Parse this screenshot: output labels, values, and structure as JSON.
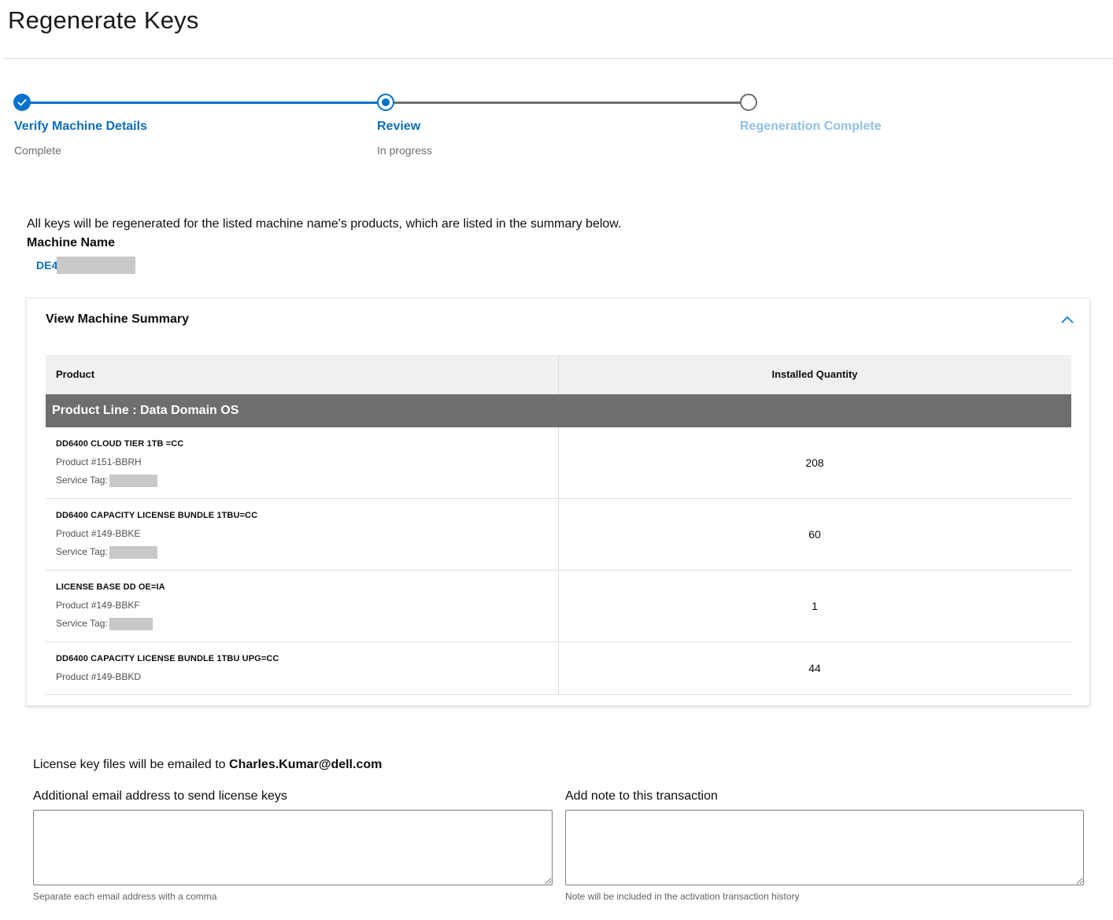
{
  "page": {
    "title": "Regenerate Keys"
  },
  "stepper": {
    "steps": [
      {
        "label": "Verify Machine Details",
        "status": "Complete"
      },
      {
        "label": "Review",
        "status": "In progress"
      },
      {
        "label": "Regeneration Complete",
        "status": ""
      }
    ]
  },
  "intro": {
    "text": "All keys will be regenerated for the listed machine name's products, which are listed in the summary below.",
    "machine_label": "Machine Name",
    "machine_name_prefix": "DE4"
  },
  "summary": {
    "title": "View Machine Summary",
    "columns": {
      "product": "Product",
      "quantity": "Installed Quantity"
    },
    "group_label": "Product Line : Data Domain OS",
    "rows": [
      {
        "name": "DD6400 CLOUD TIER 1TB =CC",
        "product_number": "Product #151-BBRH",
        "service_tag_label": "Service Tag:",
        "quantity": "208"
      },
      {
        "name": "DD6400 CAPACITY LICENSE BUNDLE 1TBU=CC",
        "product_number": "Product #149-BBKE",
        "service_tag_label": "Service Tag:",
        "quantity": "60"
      },
      {
        "name": "LICENSE BASE DD OE=IA",
        "product_number": "Product #149-BBKF",
        "service_tag_label": "Service Tag:",
        "quantity": "1"
      },
      {
        "name": "DD6400 CAPACITY LICENSE BUNDLE 1TBU UPG=CC",
        "product_number": "Product #149-BBKD",
        "quantity": "44"
      }
    ]
  },
  "email": {
    "prefix": "License key files will be emailed to ",
    "address": "Charles.Kumar@dell.com",
    "additional_label": "Additional email address to send license keys",
    "additional_helper": "Separate each email address with a comma",
    "note_label": "Add note to this transaction",
    "note_helper": "Note will be included in the activation transaction history"
  },
  "colors": {
    "accent": "#0672cb",
    "link": "#0e6eb8",
    "pending_step": "#8fc0e6",
    "group_header_bg": "#6e6e6e",
    "table_header_bg": "#f0f0f0"
  }
}
